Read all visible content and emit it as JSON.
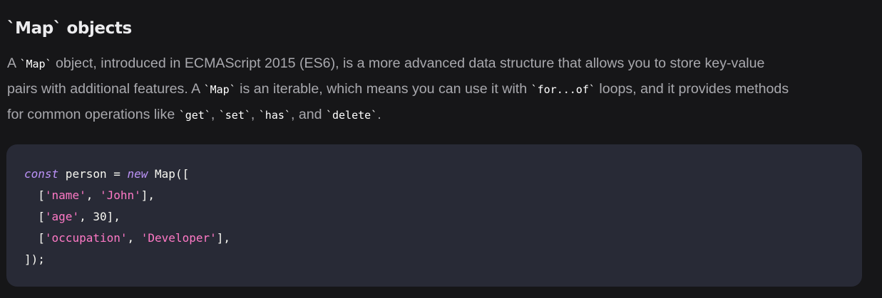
{
  "heading": {
    "code": "`Map`",
    "text": " objects"
  },
  "paragraph": {
    "line1": {
      "p1": "A ",
      "c1": "`Map`",
      "p2": " object, introduced in ECMAScript 2015 (ES6), is a more advanced data structure that allows you to store key-value"
    },
    "line2": {
      "p1": "pairs with additional features. A ",
      "c1": "`Map`",
      "p2": " is an iterable, which means you can use it with ",
      "c2": "`for...of`",
      "p3": " loops, and it provides methods"
    },
    "line3": {
      "p1": "for common operations like ",
      "c1": "`get`",
      "p2": ", ",
      "c2": "`set`",
      "p3": ", ",
      "c3": "`has`",
      "p4": ", and ",
      "c4": "`delete`",
      "p5": "."
    }
  },
  "code": {
    "line1": {
      "kw1": "const",
      "t1": " person = ",
      "kw2": "new",
      "t2": " Map(["
    },
    "line2": {
      "t1": "  [",
      "s1": "'name'",
      "t2": ", ",
      "s2": "'John'",
      "t3": "],"
    },
    "line3": {
      "t1": "  [",
      "s1": "'age'",
      "t2": ", 30],"
    },
    "line4": {
      "t1": "  [",
      "s1": "'occupation'",
      "t2": ", ",
      "s2": "'Developer'",
      "t3": "],"
    },
    "line5": {
      "t1": "]);"
    }
  },
  "colors": {
    "background": "#161618",
    "code_background": "#282a36",
    "keyword": "#bd93f9",
    "string": "#ff79c6",
    "code_text": "#f8f8f2",
    "body_text": "#a9a9ae",
    "heading_text": "#ececee"
  }
}
